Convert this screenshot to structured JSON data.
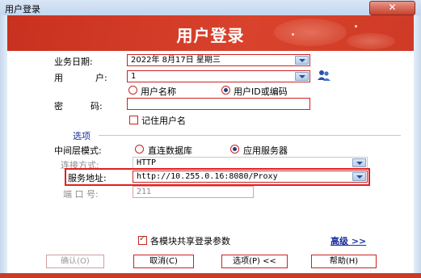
{
  "window": {
    "title": "用户登录",
    "close_glyph": "✕"
  },
  "banner": {
    "title": "用户登录"
  },
  "form": {
    "business_date_label": "业务日期:",
    "business_date_value": "2022年  8月17日  星期三",
    "user_label_1": "用",
    "user_label_2": "户:",
    "user_value": "1",
    "user_mode_name": "用户名称",
    "user_mode_id": "用户ID或编码",
    "password_label_1": "密",
    "password_label_2": "码:",
    "password_value": "",
    "remember_label": "记住用户名",
    "options_label": "选项",
    "middleware_label": "中间层模式:",
    "mode_direct": "直连数据库",
    "mode_appserver": "应用服务器",
    "conn_label": "连接方式:",
    "conn_value": "HTTP",
    "server_label": "服务地址:",
    "server_value": "http://10.255.0.16:8080/Proxy",
    "port_label": "端 口 号:",
    "port_value": "211",
    "share_label": "各模块共享登录参数",
    "advanced_label": "高级 >>"
  },
  "state": {
    "user_mode_selected": "id",
    "middleware_selected": "appserver",
    "remember_checked": false,
    "share_checked": true
  },
  "buttons": {
    "confirm": "确认(O)",
    "cancel": "取消(C)",
    "options": "选项(P) <<",
    "help": "帮助(H)"
  },
  "icons": {
    "user_picker": "users-icon",
    "dropdown": "chevron-down-icon"
  },
  "colors": {
    "brand_red": "#cc2222",
    "banner_red": "#d9432d",
    "link_blue": "#1a2fa0"
  }
}
